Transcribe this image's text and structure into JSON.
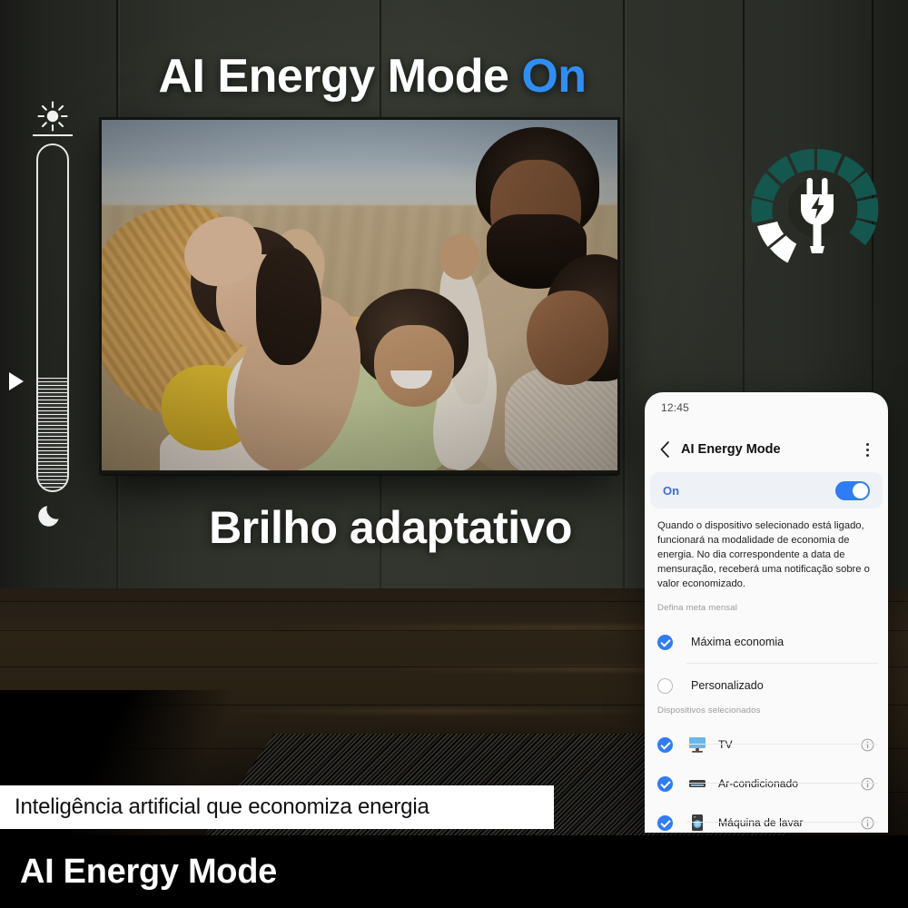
{
  "hero": {
    "title_main": "AI Energy Mode",
    "title_state": "On",
    "subtitle": "Brilho adaptativo"
  },
  "brightness_slider": {
    "sun_icon": "sun-icon",
    "moon_icon": "moon-icon",
    "marker_icon": "play-triangle-marker"
  },
  "energy_badge": {
    "icon": "power-plug-gauge-icon",
    "gauge_color": "#14574e",
    "plug_color": "#ffffff"
  },
  "phone": {
    "status_time": "12:45",
    "back_icon": "chevron-left-icon",
    "title": "AI Energy Mode",
    "menu_icon": "kebab-menu-icon",
    "toggle": {
      "label": "On",
      "state": "on",
      "accent": "#2f7cf6"
    },
    "description": "Quando o dispositivo selecionado está ligado, funcionará na modalidade de economia de energia. No dia correspondente a data de mensuração, receberá uma notificação sobre o valor economizado.",
    "goal_section_label": "Defina meta mensal",
    "goal_options": [
      {
        "label": "Máxima economia",
        "selected": true
      },
      {
        "label": "Personalizado",
        "selected": false
      }
    ],
    "devices_section_label": "Dispositivos selecionados",
    "devices": [
      {
        "label": "TV",
        "icon": "tv-icon",
        "checked": true,
        "info_icon": "info-icon"
      },
      {
        "label": "Ar-condicionado",
        "icon": "air-conditioner-icon",
        "checked": true,
        "info_icon": "info-icon"
      },
      {
        "label": "Máquina de lavar",
        "icon": "washing-machine-icon",
        "checked": true,
        "info_icon": "info-icon"
      }
    ]
  },
  "captions": {
    "overlay": "Inteligência artificial que economiza energia",
    "footer": "AI Energy Mode"
  },
  "colors": {
    "accent_blue": "#2f8ef4",
    "toggle_blue": "#2f7cf6",
    "badge_teal": "#14574e",
    "wall": "#2f322b",
    "floor": "#2a2115"
  }
}
